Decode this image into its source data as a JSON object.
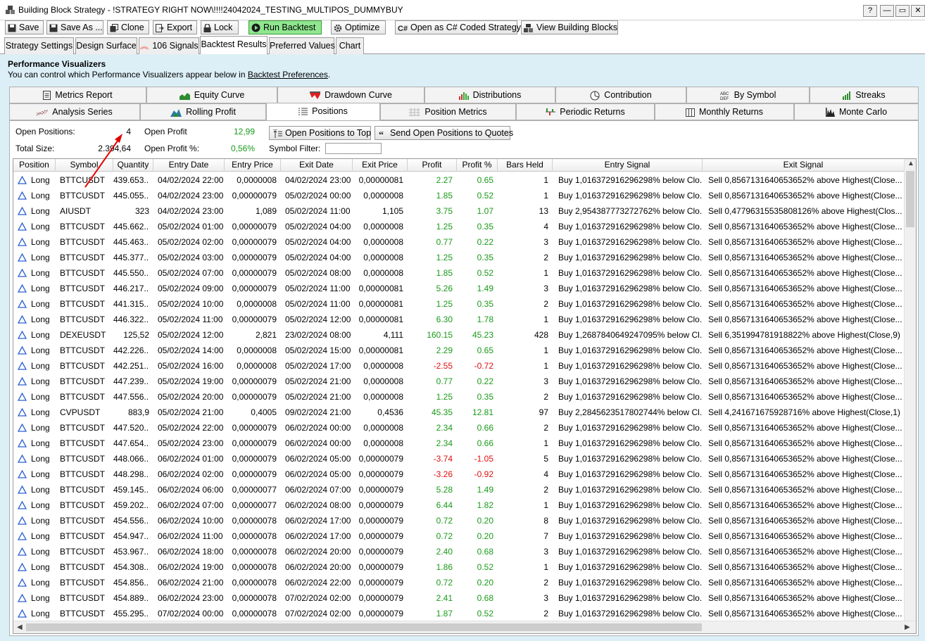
{
  "window": {
    "title": "Building Block Strategy - !STRATEGY RIGHT NOW\\!!!!24042024_TESTING_MULTIPOS_DUMMYBUY",
    "help_label": "?",
    "minimize_label": "—",
    "maximize_label": "▭",
    "close_label": "✕"
  },
  "toolbar": {
    "save": "Save",
    "save_as": "Save As ...",
    "clone": "Clone",
    "export": "Export",
    "lock": "Lock",
    "run_backtest": "Run Backtest",
    "optimize": "Optimize",
    "open_csharp": "Open as C# Coded Strategy",
    "view_blocks": "View Building Blocks"
  },
  "main_tabs": [
    "Strategy Settings",
    "Design Surface",
    "106 Signals",
    "Backtest Results",
    "Preferred Values",
    "Chart"
  ],
  "performance": {
    "title": "Performance Visualizers",
    "subtitle_prefix": "You can control which Performance Visualizers appear below in ",
    "subtitle_link": "Backtest Preferences",
    "subtitle_suffix": "."
  },
  "visualizer_tabs_row1": [
    "Metrics Report",
    "Equity Curve",
    "Drawdown Curve",
    "Distributions",
    "Contribution",
    "By Symbol",
    "Streaks"
  ],
  "visualizer_tabs_row2": [
    "Analysis Series",
    "Rolling Profit",
    "Positions",
    "Position Metrics",
    "Periodic Returns",
    "Monthly Returns",
    "Monte Carlo"
  ],
  "summary": {
    "open_positions_label": "Open Positions:",
    "open_positions_value": "4",
    "open_profit_label": "Open Profit",
    "open_profit_value": "12,99",
    "total_size_label": "Total Size:",
    "total_size_value": "2.394,64",
    "open_profit_pct_label": "Open Profit %:",
    "open_profit_pct_value": "0,56%",
    "symbol_filter_label": "Symbol Filter:",
    "open_to_top_button": "Open Positions to Top",
    "send_to_quotes_button": "Send Open Positions to Quotes"
  },
  "table": {
    "columns": [
      "Position",
      "Symbol",
      "Quantity",
      "Entry Date",
      "Entry Price",
      "Exit Date",
      "Exit Price",
      "Profit",
      "Profit %",
      "Bars Held",
      "Entry Signal",
      "Exit Signal"
    ],
    "rows": [
      [
        "Long",
        "BTTCUSDT",
        "439.653...",
        "04/02/2024 22:00",
        "0,0000008",
        "04/02/2024 23:00",
        "0,00000081",
        "2.27",
        "0.65",
        "1",
        "Buy 1,016372916296298%  below Clo...",
        "Sell 0,8567131640653652% above Highest(Close..."
      ],
      [
        "Long",
        "BTTCUSDT",
        "445.055...",
        "04/02/2024 23:00",
        "0,00000079",
        "05/02/2024 00:00",
        "0,0000008",
        "1.85",
        "0.52",
        "1",
        "Buy 1,016372916296298%  below Clo...",
        "Sell 0,8567131640653652% above Highest(Close..."
      ],
      [
        "Long",
        "AIUSDT",
        "323",
        "04/02/2024 23:00",
        "1,089",
        "05/02/2024 11:00",
        "1,105",
        "3.75",
        "1.07",
        "13",
        "Buy 2,954387773272762%  below Clo...",
        "Sell 0,47796315535808126% above Highest(Clos..."
      ],
      [
        "Long",
        "BTTCUSDT",
        "445.662...",
        "05/02/2024 01:00",
        "0,00000079",
        "05/02/2024 04:00",
        "0,0000008",
        "1.25",
        "0.35",
        "4",
        "Buy 1,016372916296298%  below Clo...",
        "Sell 0,8567131640653652% above Highest(Close..."
      ],
      [
        "Long",
        "BTTCUSDT",
        "445.463...",
        "05/02/2024 02:00",
        "0,00000079",
        "05/02/2024 04:00",
        "0,0000008",
        "0.77",
        "0.22",
        "3",
        "Buy 1,016372916296298%  below Clo...",
        "Sell 0,8567131640653652% above Highest(Close..."
      ],
      [
        "Long",
        "BTTCUSDT",
        "445.377...",
        "05/02/2024 03:00",
        "0,00000079",
        "05/02/2024 04:00",
        "0,0000008",
        "1.25",
        "0.35",
        "2",
        "Buy 1,016372916296298%  below Clo...",
        "Sell 0,8567131640653652% above Highest(Close..."
      ],
      [
        "Long",
        "BTTCUSDT",
        "445.550...",
        "05/02/2024 07:00",
        "0,00000079",
        "05/02/2024 08:00",
        "0,0000008",
        "1.85",
        "0.52",
        "1",
        "Buy 1,016372916296298%  below Clo...",
        "Sell 0,8567131640653652% above Highest(Close..."
      ],
      [
        "Long",
        "BTTCUSDT",
        "446.217...",
        "05/02/2024 09:00",
        "0,00000079",
        "05/02/2024 11:00",
        "0,00000081",
        "5.26",
        "1.49",
        "3",
        "Buy 1,016372916296298%  below Clo...",
        "Sell 0,8567131640653652% above Highest(Close..."
      ],
      [
        "Long",
        "BTTCUSDT",
        "441.315...",
        "05/02/2024 10:00",
        "0,0000008",
        "05/02/2024 11:00",
        "0,00000081",
        "1.25",
        "0.35",
        "2",
        "Buy 1,016372916296298%  below Clo...",
        "Sell 0,8567131640653652% above Highest(Close..."
      ],
      [
        "Long",
        "BTTCUSDT",
        "446.322...",
        "05/02/2024 11:00",
        "0,00000079",
        "05/02/2024 12:00",
        "0,00000081",
        "6.30",
        "1.78",
        "1",
        "Buy 1,016372916296298%  below Clo...",
        "Sell 0,8567131640653652% above Highest(Close..."
      ],
      [
        "Long",
        "DEXEUSDT",
        "125,52",
        "05/02/2024 12:00",
        "2,821",
        "23/02/2024 08:00",
        "4,111",
        "160.15",
        "45.23",
        "428",
        "Buy 1,2687840649247095%  below Cl...",
        "Sell 6,351994781918822% above Highest(Close,9)"
      ],
      [
        "Long",
        "BTTCUSDT",
        "442.226...",
        "05/02/2024 14:00",
        "0,0000008",
        "05/02/2024 15:00",
        "0,00000081",
        "2.29",
        "0.65",
        "1",
        "Buy 1,016372916296298%  below Clo...",
        "Sell 0,8567131640653652% above Highest(Close..."
      ],
      [
        "Long",
        "BTTCUSDT",
        "442.251...",
        "05/02/2024 16:00",
        "0,0000008",
        "05/02/2024 17:00",
        "0,0000008",
        "-2.55",
        "-0.72",
        "1",
        "Buy 1,016372916296298%  below Clo...",
        "Sell 0,8567131640653652% above Highest(Close..."
      ],
      [
        "Long",
        "BTTCUSDT",
        "447.239...",
        "05/02/2024 19:00",
        "0,00000079",
        "05/02/2024 21:00",
        "0,0000008",
        "0.77",
        "0.22",
        "3",
        "Buy 1,016372916296298%  below Clo...",
        "Sell 0,8567131640653652% above Highest(Close..."
      ],
      [
        "Long",
        "BTTCUSDT",
        "447.556...",
        "05/02/2024 20:00",
        "0,00000079",
        "05/02/2024 21:00",
        "0,0000008",
        "1.25",
        "0.35",
        "2",
        "Buy 1,016372916296298%  below Clo...",
        "Sell 0,8567131640653652% above Highest(Close..."
      ],
      [
        "Long",
        "CVPUSDT",
        "883,9",
        "05/02/2024 21:00",
        "0,4005",
        "09/02/2024 21:00",
        "0,4536",
        "45.35",
        "12.81",
        "97",
        "Buy 2,2845623517802744%  below Cl...",
        "Sell 4,241671675928716% above Highest(Close,1)"
      ],
      [
        "Long",
        "BTTCUSDT",
        "447.520...",
        "05/02/2024 22:00",
        "0,00000079",
        "06/02/2024 00:00",
        "0,0000008",
        "2.34",
        "0.66",
        "2",
        "Buy 1,016372916296298%  below Clo...",
        "Sell 0,8567131640653652% above Highest(Close..."
      ],
      [
        "Long",
        "BTTCUSDT",
        "447.654...",
        "05/02/2024 23:00",
        "0,00000079",
        "06/02/2024 00:00",
        "0,0000008",
        "2.34",
        "0.66",
        "1",
        "Buy 1,016372916296298%  below Clo...",
        "Sell 0,8567131640653652% above Highest(Close..."
      ],
      [
        "Long",
        "BTTCUSDT",
        "448.066...",
        "06/02/2024 01:00",
        "0,00000079",
        "06/02/2024 05:00",
        "0,00000079",
        "-3.74",
        "-1.05",
        "5",
        "Buy 1,016372916296298%  below Clo...",
        "Sell 0,8567131640653652% above Highest(Close..."
      ],
      [
        "Long",
        "BTTCUSDT",
        "448.298...",
        "06/02/2024 02:00",
        "0,00000079",
        "06/02/2024 05:00",
        "0,00000079",
        "-3.26",
        "-0.92",
        "4",
        "Buy 1,016372916296298%  below Clo...",
        "Sell 0,8567131640653652% above Highest(Close..."
      ],
      [
        "Long",
        "BTTCUSDT",
        "459.145...",
        "06/02/2024 06:00",
        "0,00000077",
        "06/02/2024 07:00",
        "0,00000079",
        "5.28",
        "1.49",
        "2",
        "Buy 1,016372916296298%  below Clo...",
        "Sell 0,8567131640653652% above Highest(Close..."
      ],
      [
        "Long",
        "BTTCUSDT",
        "459.202...",
        "06/02/2024 07:00",
        "0,00000077",
        "06/02/2024 08:00",
        "0,00000079",
        "6.44",
        "1.82",
        "1",
        "Buy 1,016372916296298%  below Clo...",
        "Sell 0,8567131640653652% above Highest(Close..."
      ],
      [
        "Long",
        "BTTCUSDT",
        "454.556...",
        "06/02/2024 10:00",
        "0,00000078",
        "06/02/2024 17:00",
        "0,00000079",
        "0.72",
        "0.20",
        "8",
        "Buy 1,016372916296298%  below Clo...",
        "Sell 0,8567131640653652% above Highest(Close..."
      ],
      [
        "Long",
        "BTTCUSDT",
        "454.947...",
        "06/02/2024 11:00",
        "0,00000078",
        "06/02/2024 17:00",
        "0,00000079",
        "0.72",
        "0.20",
        "7",
        "Buy 1,016372916296298%  below Clo...",
        "Sell 0,8567131640653652% above Highest(Close..."
      ],
      [
        "Long",
        "BTTCUSDT",
        "453.967...",
        "06/02/2024 18:00",
        "0,00000078",
        "06/02/2024 20:00",
        "0,00000079",
        "2.40",
        "0.68",
        "3",
        "Buy 1,016372916296298%  below Clo...",
        "Sell 0,8567131640653652% above Highest(Close..."
      ],
      [
        "Long",
        "BTTCUSDT",
        "454.308...",
        "06/02/2024 19:00",
        "0,00000078",
        "06/02/2024 20:00",
        "0,00000079",
        "1.86",
        "0.52",
        "1",
        "Buy 1,016372916296298%  below Clo...",
        "Sell 0,8567131640653652% above Highest(Close..."
      ],
      [
        "Long",
        "BTTCUSDT",
        "454.856...",
        "06/02/2024 21:00",
        "0,00000078",
        "06/02/2024 22:00",
        "0,00000079",
        "0.72",
        "0.20",
        "2",
        "Buy 1,016372916296298%  below Clo...",
        "Sell 0,8567131640653652% above Highest(Close..."
      ],
      [
        "Long",
        "BTTCUSDT",
        "454.889...",
        "06/02/2024 23:00",
        "0,00000078",
        "07/02/2024 02:00",
        "0,00000079",
        "2.41",
        "0.68",
        "3",
        "Buy 1,016372916296298%  below Clo...",
        "Sell 0,8567131640653652% above Highest(Close..."
      ],
      [
        "Long",
        "BTTCUSDT",
        "455.295...",
        "07/02/2024 00:00",
        "0,00000078",
        "07/02/2024 02:00",
        "0,00000079",
        "1.87",
        "0.52",
        "2",
        "Buy 1,016372916296298%  below Clo...",
        "Sell 0,8567131640653652% above Highest(Close..."
      ]
    ]
  },
  "colors": {
    "positive": "#1a9a1a",
    "negative": "#e01010",
    "annotation_arrow": "#e00000",
    "content_background": "#dceff7",
    "run_button": "#8fe78f",
    "long_triangle": "#2a5fd0"
  }
}
